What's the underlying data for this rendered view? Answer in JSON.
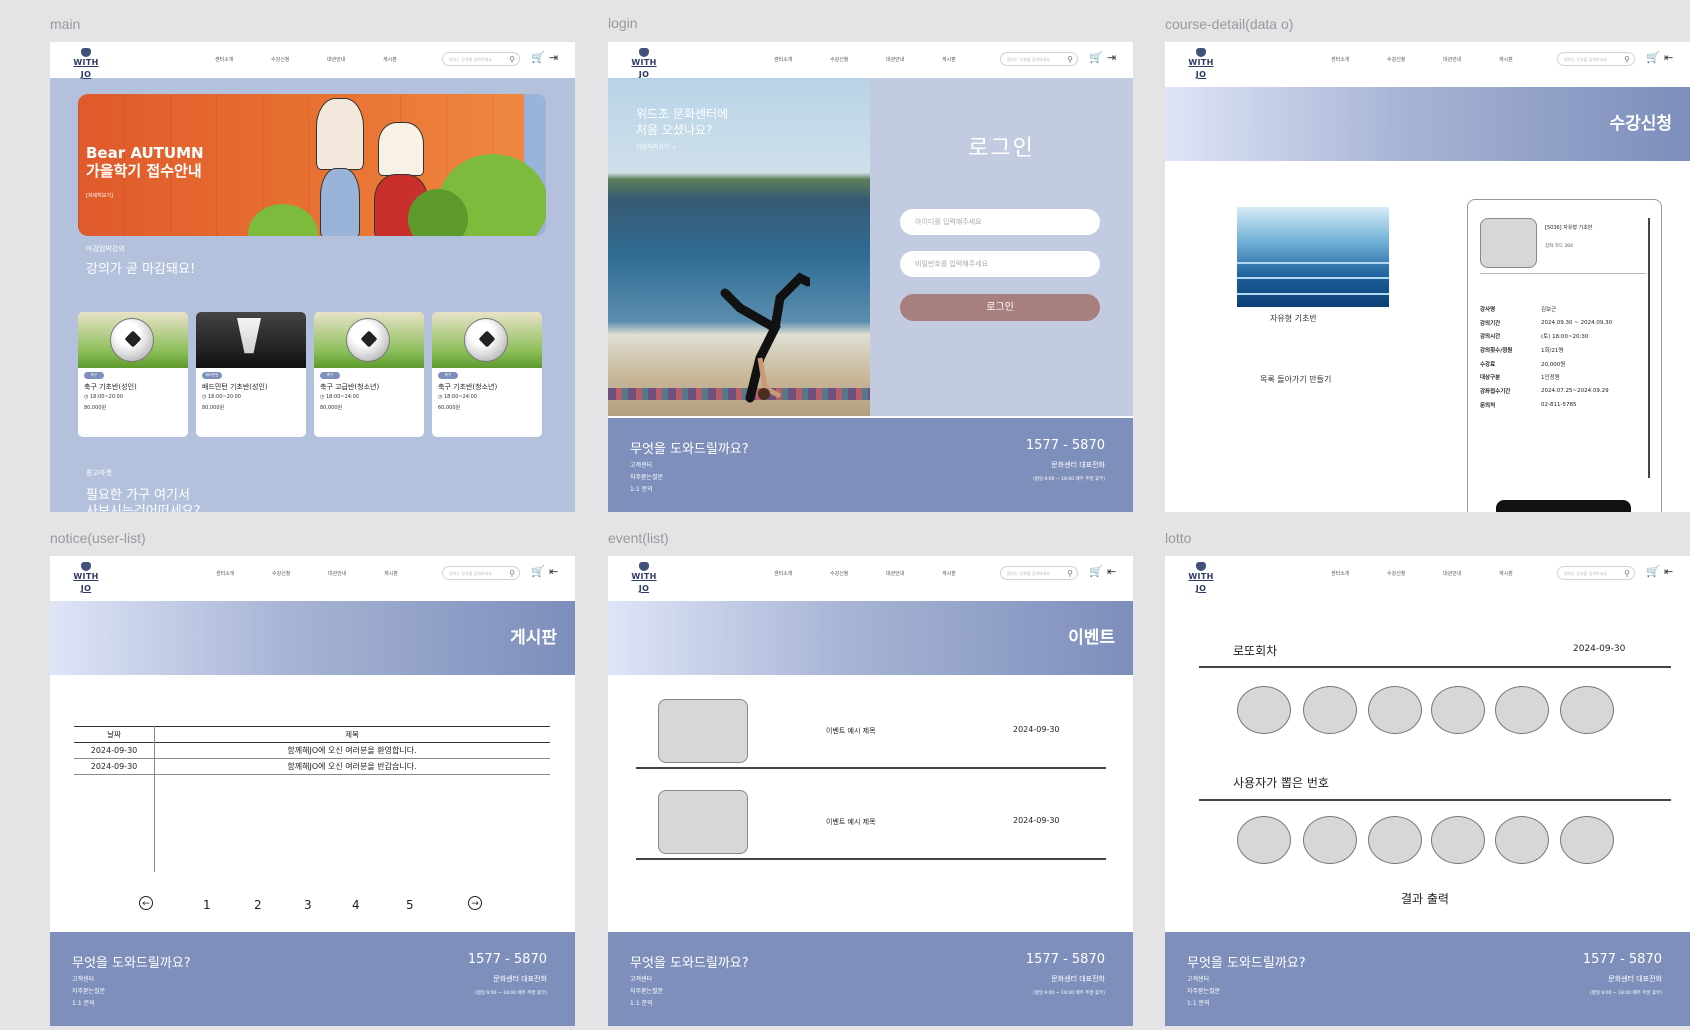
{
  "labels": {
    "main": "main",
    "login": "login",
    "course_detail": "course-detail(data o)",
    "notice": "notice(user-list)",
    "event": "event(list)",
    "lotto": "lotto"
  },
  "header": {
    "logo": "WITH JO",
    "nav": [
      "센터소개",
      "수강신청",
      "대관안내",
      "게시판"
    ],
    "search_placeholder": "원하는 강좌를 검색하세요"
  },
  "footer": {
    "question": "무엇을 도와드릴까요?",
    "links": [
      "고객센터",
      "자주묻는질문",
      "1:1 문의"
    ],
    "phone": "1577 - 5870",
    "phone_label": "문화센터 대표전화",
    "hours": "(평일 9:00 ~ 18:00 매주 주말 휴무)"
  },
  "main": {
    "hero_line1": "Bear AUTUMN",
    "hero_line2": "가을학기 접수안내",
    "hero_more": "[자세히보기]",
    "section1_sub": "마감임박강의",
    "section1_title": "강의가 곧 마감돼요!",
    "courses": [
      {
        "badge": "축구",
        "name": "축구 기초반(성인)",
        "time": "18:00~20:00",
        "price": "80,000원"
      },
      {
        "badge": "배드민턴",
        "name": "배드민턴 기초반(성인)",
        "time": "18:00~20:00",
        "price": "80,000원"
      },
      {
        "badge": "축구",
        "name": "축구 고급반(청소년)",
        "time": "18:00~24:00",
        "price": "80,000원"
      },
      {
        "badge": "축구",
        "name": "축구 기초반(청소년)",
        "time": "18:00~24:00",
        "price": "60,000원"
      }
    ],
    "section2_sub": "중고마켓",
    "section2_title": "필요한 가구 여기서",
    "section2_title2": "사보시는건어떠세요?"
  },
  "login": {
    "photo_line1": "위드조 문화센터에",
    "photo_line2": "처음 오셨나요?",
    "photo_link": "가입하러가기 →",
    "title": "로그인",
    "id_placeholder": "아이디를 입력해주세요",
    "pw_placeholder": "비밀번호를 입력해주세요",
    "button": "로그인"
  },
  "course_detail": {
    "banner": "수강신청",
    "image_caption": "자유형 기초반",
    "back_link": "목록 돌아가기 만들기",
    "card_title": "[5036] 자유형 기초반",
    "card_sub": "강좌 코드 304",
    "details": [
      {
        "k": "강사명",
        "v": "김보근"
      },
      {
        "k": "강의기간",
        "v": "2024.09.30 ~ 2024.09.30"
      },
      {
        "k": "강의시간",
        "v": "(토) 18:00~20:30"
      },
      {
        "k": "강의횟수/정원",
        "v": "1회/21명"
      },
      {
        "k": "수강료",
        "v": "20,000원"
      },
      {
        "k": "대상구분",
        "v": "1인정원"
      },
      {
        "k": "강좌접수기간",
        "v": "2024.07.25~2024.09.29"
      },
      {
        "k": "문의처",
        "v": "02-811-5785"
      }
    ]
  },
  "notice": {
    "banner": "게시판",
    "col_date": "날짜",
    "col_title": "제목",
    "rows": [
      {
        "date": "2024-09-30",
        "title": "함께해JO에 오신 여러분을 환영합니다."
      },
      {
        "date": "2024-09-30",
        "title": "함께해JO에 오신 여러분을 반갑습니다."
      }
    ],
    "pages": [
      "1",
      "2",
      "3",
      "4",
      "5"
    ],
    "prev": "←",
    "next": "→"
  },
  "event": {
    "banner": "이벤트",
    "items": [
      {
        "title": "이벤트 예시 제목",
        "date": "2024-09-30"
      },
      {
        "title": "이벤트 예시 제목",
        "date": "2024-09-30"
      }
    ]
  },
  "lotto": {
    "round_label": "로또회차",
    "date": "2024-09-30",
    "user_label": "사용자가 뽑은 번호",
    "result": "결과 출력"
  },
  "colors": {
    "footer": "#7e8fbb",
    "login_panel": "#c2cbe0",
    "login_button": "#a77f7e",
    "main_bg": "#b3c1dd"
  }
}
